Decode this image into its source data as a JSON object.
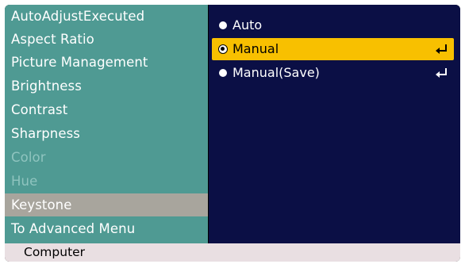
{
  "menu": {
    "items": [
      {
        "label": "AutoAdjustExecuted",
        "state": "normal"
      },
      {
        "label": "Aspect Ratio",
        "state": "normal"
      },
      {
        "label": "Picture Management",
        "state": "normal"
      },
      {
        "label": "Brightness",
        "state": "normal"
      },
      {
        "label": "Contrast",
        "state": "normal"
      },
      {
        "label": "Sharpness",
        "state": "normal"
      },
      {
        "label": "Color",
        "state": "disabled"
      },
      {
        "label": "Hue",
        "state": "disabled"
      },
      {
        "label": "Keystone",
        "state": "selected"
      },
      {
        "label": "To Advanced Menu",
        "state": "normal"
      }
    ]
  },
  "options": {
    "items": [
      {
        "label": "Auto",
        "marker": "bullet",
        "enter_icon": false
      },
      {
        "label": "Manual",
        "marker": "radio-selected",
        "enter_icon": true,
        "highlighted": true
      },
      {
        "label": "Manual(Save)",
        "marker": "bullet",
        "enter_icon": true
      }
    ]
  },
  "status": {
    "source": "Computer"
  },
  "colors": {
    "menu_bg": "#4f9a93",
    "menu_selected_bg": "#a8a59d",
    "menu_disabled_text": "#8fc4bf",
    "options_bg": "#0b0f45",
    "highlight": "#f8c000",
    "status_bg": "#e9dfe2"
  },
  "icons": {
    "enter": "enter-arrow-icon",
    "bullet": "bullet-icon",
    "radio": "radio-selected-icon"
  }
}
